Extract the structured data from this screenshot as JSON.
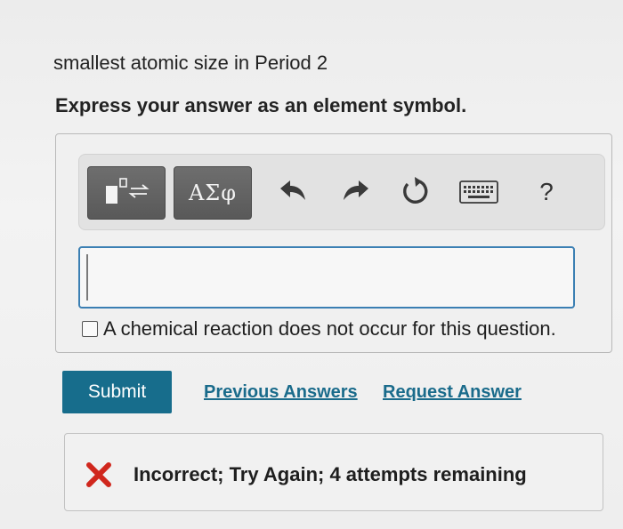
{
  "question": {
    "prompt": "smallest atomic size in Period 2",
    "instruction": "Express your answer as an element symbol."
  },
  "toolbar": {
    "template_icon": "template-subscript-equilibrium-icon",
    "symbols_label": "ΑΣφ",
    "undo_icon": "undo-icon",
    "redo_icon": "redo-icon",
    "reset_icon": "reset-icon",
    "keyboard_icon": "keyboard-icon",
    "help_label": "?"
  },
  "answer": {
    "value": "",
    "placeholder": ""
  },
  "no_reaction": {
    "checked": false,
    "label": "A chemical reaction does not occur for this question."
  },
  "actions": {
    "submit_label": "Submit",
    "previous_answers_label": "Previous Answers",
    "request_answer_label": "Request Answer"
  },
  "feedback": {
    "icon": "incorrect-x-icon",
    "message": "Incorrect; Try Again; 4 attempts remaining"
  },
  "colors": {
    "submit_bg": "#176d8c",
    "link": "#1a6b8b",
    "input_border": "#3b7fb3",
    "incorrect": "#d0271d",
    "toolbar_dark": "#5f5f5f"
  }
}
